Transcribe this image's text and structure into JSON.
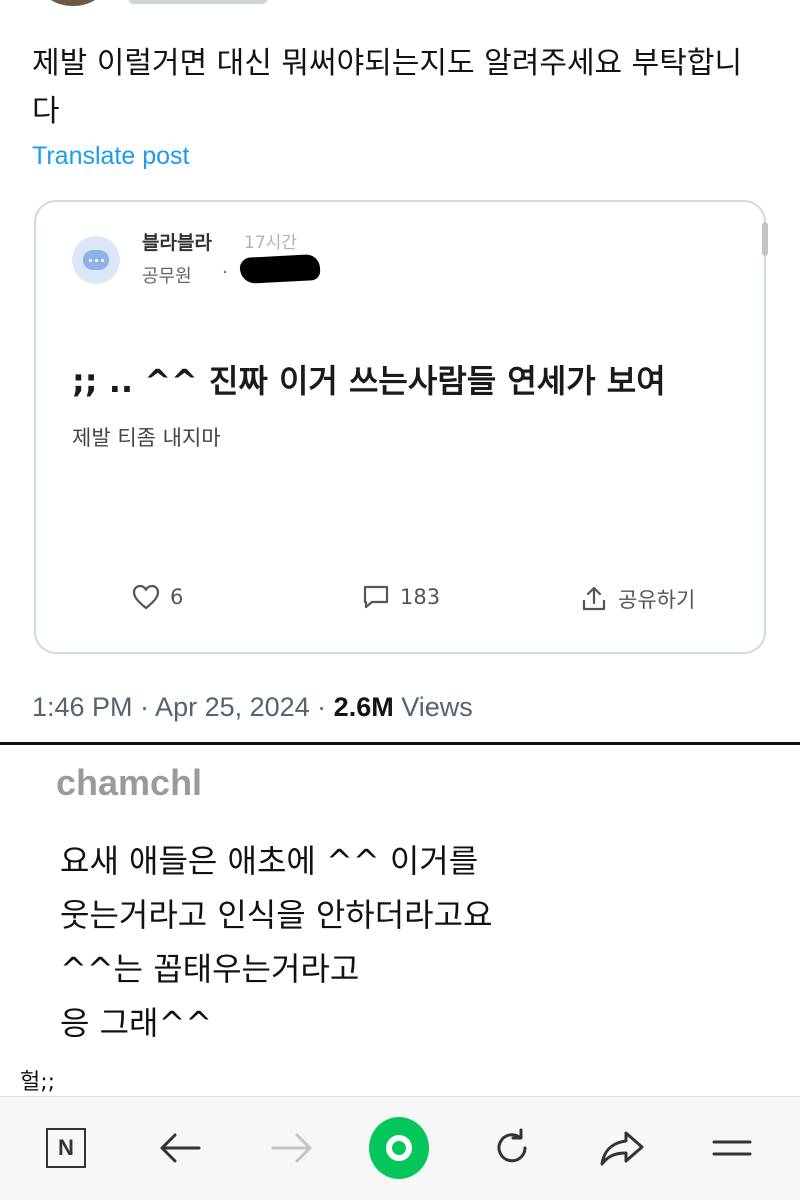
{
  "tweet": {
    "text": "제발 이럴거면 대신 뭐써야되는지도 알려주세요 부탁합니다",
    "translate_label": "Translate post",
    "timestamp": "1:46 PM · Apr 25, 2024 · ",
    "views_count": "2.6M",
    "views_label": " Views"
  },
  "quoted_card": {
    "author": "블라블라",
    "time_ago": "17시간",
    "job": "공무원",
    "separator": "·",
    "title": ";; .. ^^ 진짜 이거 쓰는사람들 연세가 보여",
    "body": "제발 티좀 내지마",
    "likes": "6",
    "comments": "183",
    "share_label": "공유하기"
  },
  "comment": {
    "username": "chamchl",
    "lines": [
      "요새 애들은 애초에 ^^ 이거를",
      "웃는거라고 인식을 안하더라고요",
      "^^는 꼽태우는거라고",
      "응 그래^^"
    ]
  },
  "caption": "헐;;",
  "bottom_nav": {
    "n_button": "N",
    "icons": [
      "naver-n-icon",
      "back-arrow-icon",
      "forward-arrow-icon",
      "home-green-icon",
      "refresh-icon",
      "share-icon",
      "menu-icon"
    ]
  },
  "colors": {
    "link_blue": "#1d9bf0",
    "naver_green": "#03c75a",
    "meta_gray": "#536471"
  }
}
